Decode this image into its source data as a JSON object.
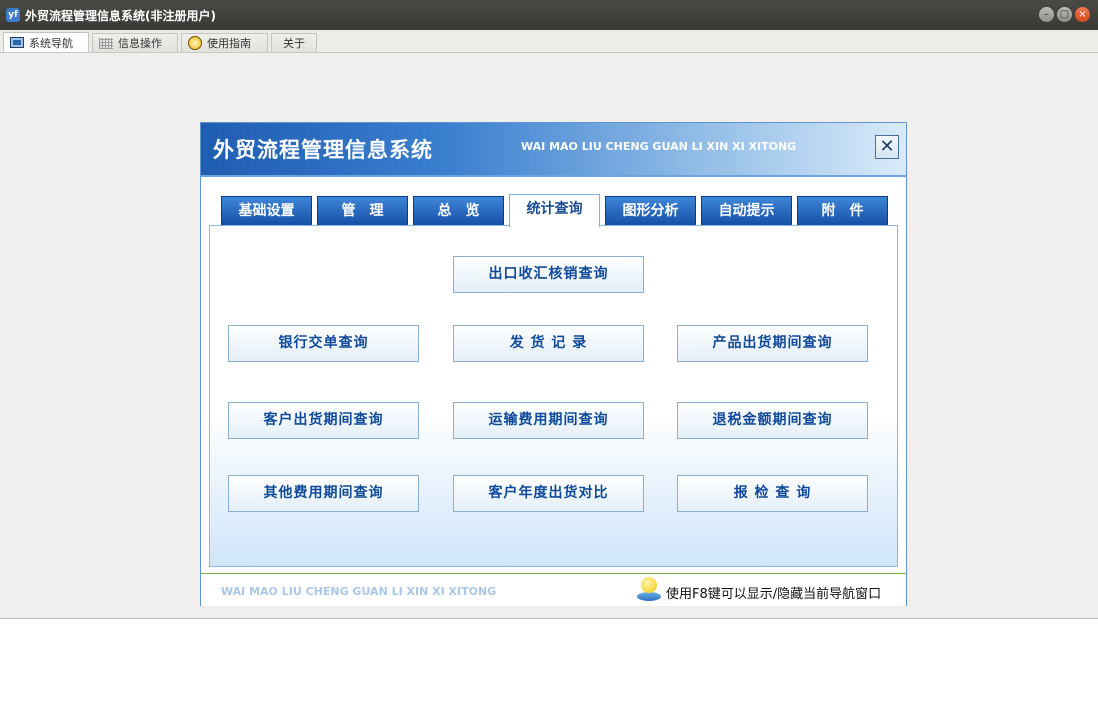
{
  "window": {
    "title": "外贸流程管理信息系统(非注册用户)",
    "app_icon_letter": "yf"
  },
  "tabs": [
    {
      "label": "系统导航",
      "icon": "monitor-icon",
      "active": true
    },
    {
      "label": "信息操作",
      "icon": "grid-icon",
      "active": false
    },
    {
      "label": "使用指南",
      "icon": "help-icon",
      "active": false
    },
    {
      "label": "关于",
      "icon": "",
      "active": false
    }
  ],
  "panel": {
    "title": "外贸流程管理信息系统",
    "subtitle": "WAI MAO LIU CHENG GUAN LI XIN XI XITONG",
    "close_glyph": "✕",
    "nav_tabs": [
      "基础设置",
      "管　理",
      "总　览",
      "统计查询",
      "图形分析",
      "自动提示",
      "附　件"
    ],
    "active_nav": "统计查询",
    "buttons": [
      "出口收汇核销查询",
      "银行交单查询",
      "发 货 记 录",
      "产品出货期间查询",
      "客户出货期间查询",
      "运输费用期间查询",
      "退税金额期间查询",
      "其他费用期间查询",
      "客户年度出货对比",
      "报 检 查 询"
    ],
    "footer_subtitle": "WAI MAO LIU CHENG GUAN LI XIN XI XITONG",
    "footer_hint": "使用F8键可以显示/隐藏当前导航窗口"
  },
  "colors": {
    "title_bar": "#3f3e3a",
    "panel_blue": "#1f5db1",
    "button_text": "#0f4a9a",
    "close_red": "#e0531f"
  }
}
